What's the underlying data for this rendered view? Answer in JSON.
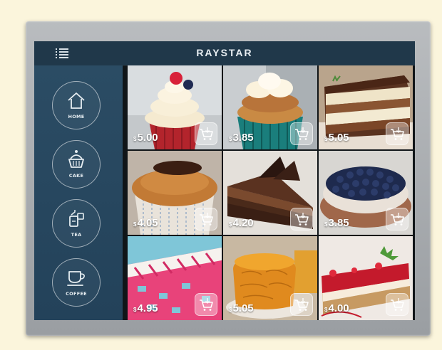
{
  "app": {
    "title": "RAYSTAR"
  },
  "sidebar": {
    "items": [
      {
        "label": "HOME",
        "icon": "home-icon"
      },
      {
        "label": "CAKE",
        "icon": "cake-icon"
      },
      {
        "label": "TEA",
        "icon": "tea-icon"
      },
      {
        "label": "COFFEE",
        "icon": "coffee-icon"
      }
    ]
  },
  "products": [
    {
      "currency": "$",
      "price": "5.00"
    },
    {
      "currency": "$",
      "price": "3.85"
    },
    {
      "currency": "$",
      "price": "5.05"
    },
    {
      "currency": "$",
      "price": "4.05"
    },
    {
      "currency": "$",
      "price": "4.20"
    },
    {
      "currency": "$",
      "price": "3.85"
    },
    {
      "currency": "$",
      "price": "4.95"
    },
    {
      "currency": "$",
      "price": "5.05"
    },
    {
      "currency": "$",
      "price": "4.00"
    }
  ],
  "colors": {
    "topbar": "#20384a",
    "sidebar": "#2b4c64",
    "bezel": "#9a9ea2",
    "background": "#fbf5dc"
  }
}
